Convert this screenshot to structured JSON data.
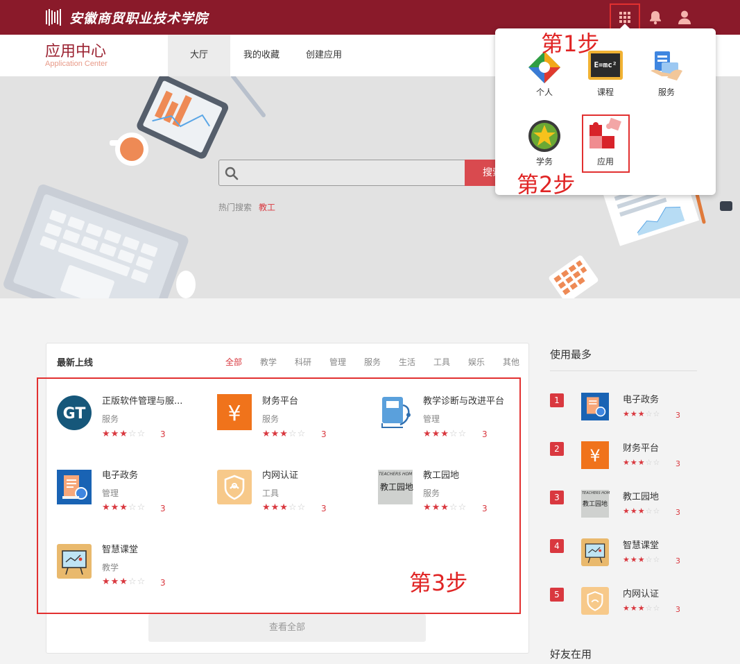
{
  "header": {
    "school_name": "安徽商贸职业技术学院",
    "apps_icon": "grid-apps-icon",
    "bell_icon": "bell-icon",
    "user_icon": "user-icon",
    "brand_color": "#8a1a2a"
  },
  "nav": {
    "title": "应用中心",
    "subtitle": "Application Center",
    "tabs": [
      {
        "label": "大厅",
        "active": true
      },
      {
        "label": "我的收藏",
        "active": false
      },
      {
        "label": "创建应用",
        "active": false
      }
    ]
  },
  "hero": {
    "search_placeholder": "",
    "search_button": "搜索",
    "hot_label": "热门搜索",
    "hot_keyword": "教工"
  },
  "popup": {
    "items": [
      {
        "label": "个人",
        "icon": "personal-icon"
      },
      {
        "label": "课程",
        "icon": "course-blackboard-icon"
      },
      {
        "label": "服务",
        "icon": "service-icon"
      },
      {
        "label": "学务",
        "icon": "academic-star-icon"
      },
      {
        "label": "应用",
        "icon": "puzzle-app-icon"
      }
    ]
  },
  "annotations": {
    "step1": "第1步",
    "step2": "第2步",
    "step3": "第3步",
    "highlight_color": "#e23030"
  },
  "latest": {
    "title": "最新上线",
    "categories": [
      "全部",
      "教学",
      "科研",
      "管理",
      "服务",
      "生活",
      "工具",
      "娱乐",
      "其他"
    ],
    "active_category": "全部",
    "apps": [
      {
        "name": "正版软件管理与服...",
        "category": "服务",
        "rating": 3,
        "score": "3",
        "icon": "gt-logo-icon"
      },
      {
        "name": "财务平台",
        "category": "服务",
        "rating": 3,
        "score": "3",
        "icon": "yuan-finance-icon"
      },
      {
        "name": "教学诊断与改进平台",
        "category": "管理",
        "rating": 3,
        "score": "3",
        "icon": "book-stethoscope-icon"
      },
      {
        "name": "电子政务",
        "category": "管理",
        "rating": 3,
        "score": "3",
        "icon": "e-government-document-icon"
      },
      {
        "name": "内网认证",
        "category": "工具",
        "rating": 3,
        "score": "3",
        "icon": "shield-auth-icon"
      },
      {
        "name": "教工园地",
        "category": "服务",
        "rating": 3,
        "score": "3",
        "icon": "teachers-home-icon"
      },
      {
        "name": "智慧课堂",
        "category": "教学",
        "rating": 3,
        "score": "3",
        "icon": "smart-classroom-board-icon"
      }
    ],
    "view_all": "查看全部"
  },
  "most_used": {
    "title": "使用最多",
    "items": [
      {
        "rank": "1",
        "name": "电子政务",
        "rating": 3,
        "score": "3",
        "icon": "e-government-document-icon"
      },
      {
        "rank": "2",
        "name": "财务平台",
        "rating": 3,
        "score": "3",
        "icon": "yuan-finance-icon"
      },
      {
        "rank": "3",
        "name": "教工园地",
        "rating": 3,
        "score": "3",
        "icon": "teachers-home-icon"
      },
      {
        "rank": "4",
        "name": "智慧课堂",
        "rating": 3,
        "score": "3",
        "icon": "smart-classroom-board-icon"
      },
      {
        "rank": "5",
        "name": "内网认证",
        "rating": 3,
        "score": "3",
        "icon": "shield-auth-icon"
      }
    ]
  },
  "friends": {
    "title": "好友在用"
  },
  "icon_text": {
    "emc": "E=mc²",
    "teachers_home": "TEACHERS HOM",
    "teachers_home_cn": "教工园地"
  }
}
